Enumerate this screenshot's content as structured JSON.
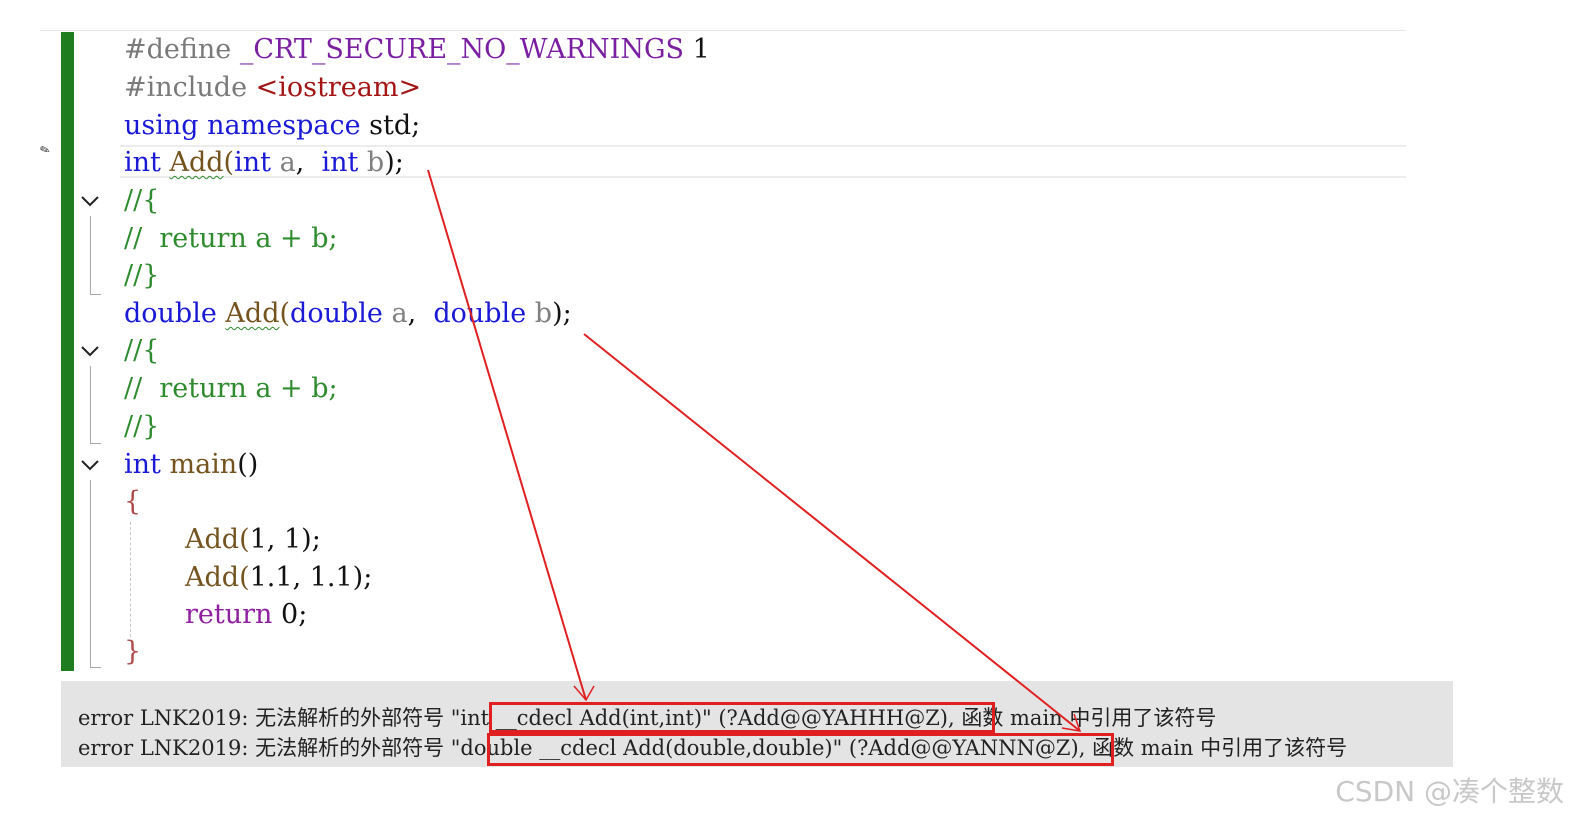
{
  "code": {
    "line1": {
      "directive": "#define",
      "macro": "_CRT_SECURE_NO_WARNINGS",
      "value": "1"
    },
    "line2": {
      "directive": "#include",
      "header": "<iostream>"
    },
    "line3": {
      "kw1": "using",
      "kw2": "namespace",
      "rest": "std;"
    },
    "line4": {
      "type": "int",
      "name": "Add",
      "open": "(",
      "type_a": "int",
      "param_a": "a",
      "comma": ",",
      "type_b": "int",
      "param_b": "b",
      "close": ");"
    },
    "line5": "//{",
    "line6": {
      "slashes": "//",
      "body": "return a + b;"
    },
    "line7": "//}",
    "line8": {
      "type": "double",
      "name": "Add",
      "open": "(",
      "type_a": "double",
      "param_a": "a",
      "comma": ",",
      "type_b": "double",
      "param_b": "b",
      "close": ");"
    },
    "line9": "//{",
    "line10": {
      "slashes": "//",
      "body": "return a + b;"
    },
    "line11": "//}",
    "line12": {
      "type": "int",
      "name": "main",
      "parens": "()"
    },
    "line13": "{",
    "line14": {
      "name": "Add",
      "open": "(",
      "args": "1, 1",
      "close": ");"
    },
    "line15": {
      "name": "Add",
      "open": "(",
      "args": "1.1, 1.1",
      "close": ");"
    },
    "line16": {
      "kw": "return",
      "rest": "0;"
    },
    "line17": "}"
  },
  "errors": [
    {
      "prefix": "error LNK2019: 无法解析的外部符号 \"",
      "symbol": "int __cdecl Add(int,int)\" (?Add@@YAHHH@Z),",
      "suffix": " 函数 main 中引用了该符号"
    },
    {
      "prefix": "error LNK2019: 无法解析的外部符号 \"",
      "symbol": "double __cdecl Add(double,double)\" (?Add@@YANNN@Z),",
      "suffix": " 函数 main 中引用了该符号"
    }
  ],
  "watermark": "CSDN @凑个整数",
  "colors": {
    "keyword": "#1a1ad6",
    "comment": "#2e8b2e",
    "change_bar": "#1e7d1e",
    "annotation": "#e02020"
  },
  "icons": {
    "fold": "chevron-down-icon",
    "edit": "pen-icon"
  }
}
